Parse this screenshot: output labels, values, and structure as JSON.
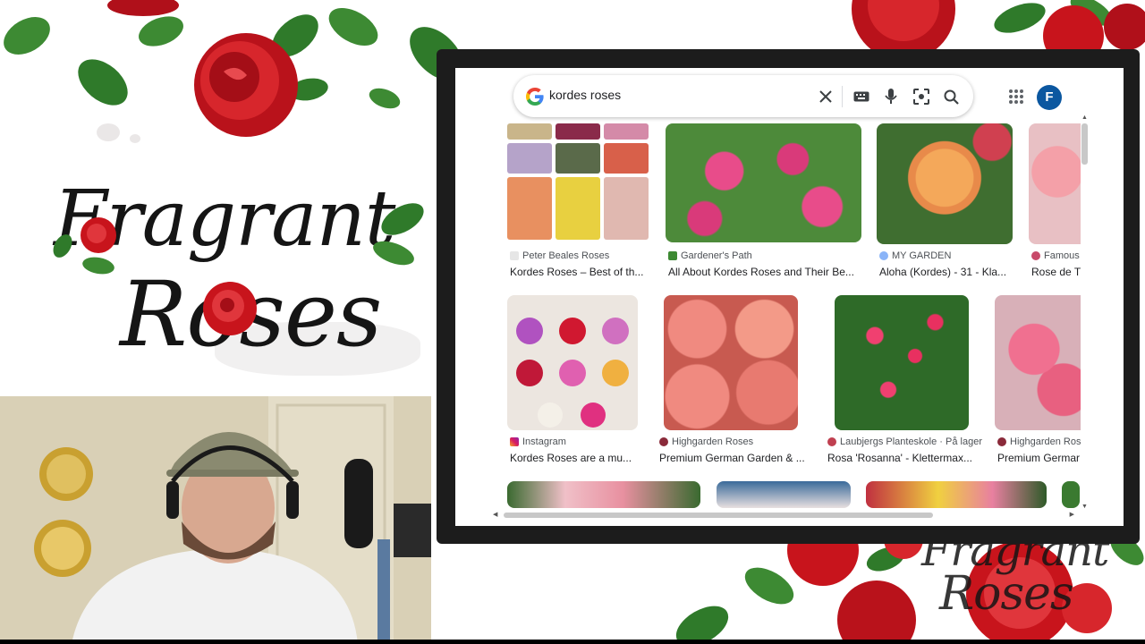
{
  "branding": {
    "logo_line1": "Fragrant",
    "logo_line2": "Roses",
    "corner_logo_line1": "Fragrant",
    "corner_logo_line2": "Roses"
  },
  "browser": {
    "search": {
      "query": "kordes roses",
      "icons": [
        "google-g-icon",
        "clear-icon",
        "keyboard-icon",
        "microphone-icon",
        "lens-icon",
        "search-icon"
      ]
    },
    "header": {
      "apps_icon": "apps-grid-icon",
      "avatar_letter": "F",
      "avatar_color": "#0b57a0"
    },
    "results_row1": [
      {
        "source": "Peter Beales Roses",
        "title": "Kordes Roses – Best of th..."
      },
      {
        "source": "Gardener's Path",
        "title": "All About Kordes Roses and Their Be..."
      },
      {
        "source": "MY GARDEN",
        "title": "Aloha (Kordes) - 31 - Kla..."
      },
      {
        "source": "Famous",
        "title": "Rose de T"
      }
    ],
    "results_row2": [
      {
        "source": "Instagram",
        "title": "Kordes Roses are a mu..."
      },
      {
        "source": "Highgarden Roses",
        "title": "Premium German Garden & ..."
      },
      {
        "source": "Laubjergs Planteskole · På lager",
        "title": "Rosa 'Rosanna' - Klettermax..."
      },
      {
        "source": "Highgarden Rose",
        "title": "Premium Germar"
      }
    ]
  },
  "colors": {
    "rose_red": "#c8141c",
    "leaf_green": "#2f7a2a",
    "monitor": "#1c1c1c"
  }
}
